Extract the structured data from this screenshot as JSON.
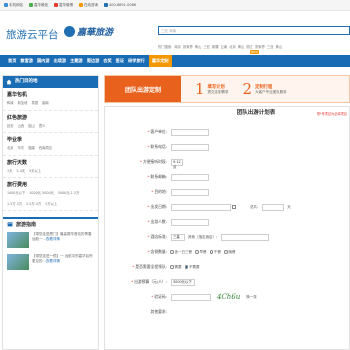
{
  "topbar": {
    "links": [
      {
        "icon": "mobile-icon",
        "label": "手机网站",
        "color": "#3a8fd8"
      },
      {
        "icon": "wechat-icon",
        "label": "嘉华微信",
        "color": "#4caf50"
      },
      {
        "icon": "weibo-icon",
        "label": "嘉华微博",
        "color": "#e53935"
      },
      {
        "icon": "tiktok-icon",
        "label": "在线咨询",
        "color": "#f39800"
      },
      {
        "icon": "phone-icon",
        "label": "400-8891-0066",
        "color": "#1f6fb2"
      }
    ]
  },
  "header": {
    "brand": "旅游云平台",
    "logo_text": "嘉華旅游",
    "search_placeholder": "三亚 海南",
    "hotlinks": [
      "热门搜索:",
      "南京",
      "张家界",
      "黄山",
      "三亚",
      "新疆",
      "云南",
      "北京",
      "黄山",
      "丽江",
      "张家界",
      "三亚",
      "黄山"
    ]
  },
  "nav": {
    "items": [
      "首页",
      "散客游",
      "国内游",
      "出境游",
      "主题游",
      "周边游",
      "会奖",
      "签证",
      "研学旅行",
      "嘉华定制"
    ],
    "active_index": 9,
    "badge": "NEW"
  },
  "sidebar": {
    "title": "热门目的地",
    "sections": [
      {
        "title": "嘉华包机",
        "items": [
          "鸭绿",
          "新加坡",
          "泰国",
          "越南"
        ]
      },
      {
        "title": "红色旅游",
        "items": [
          "延安",
          "山西",
          "韶山",
          "遵义"
        ]
      },
      {
        "title": "毕业季",
        "items": [
          "北京",
          "华东",
          "福建",
          "西南周边"
        ]
      },
      {
        "title": "旅行天数",
        "items": [
          "1天",
          "2-4天",
          "5天以上"
        ]
      },
      {
        "title": "旅行费用",
        "items": [
          "1000元以下",
          "1000元-5000元",
          "5000元-1.5万",
          "1.5万-3万",
          "2.5万-5万",
          "5万以上"
        ]
      }
    ],
    "guide_title": "旅游指南",
    "guides": [
      {
        "title": "【带您走进厦门】最高赛华首站的青春远航一...",
        "more": "查看详情"
      },
      {
        "title": "【带您走进一镜】一 远航中的嘉华后所 更见的...",
        "more": "查看详情"
      }
    ]
  },
  "banner": {
    "title": "团队出游定制",
    "steps": [
      {
        "num": "1",
        "a": "填写计划",
        "b": "提交定制需求"
      },
      {
        "num": "2",
        "a": "定制行程",
        "b": "大客户专业团队服务"
      }
    ]
  },
  "form": {
    "title": "团队出游计划表",
    "note": "带*号项目为必填项目",
    "fields": [
      {
        "label": "客户单位:",
        "req": true,
        "type": "input",
        "value": ""
      },
      {
        "label": "联系电话:",
        "req": true,
        "type": "input",
        "value": ""
      },
      {
        "label": "方便接听时段:",
        "req": true,
        "type": "select",
        "value": "9-12点"
      },
      {
        "label": "联系邮箱:",
        "req": true,
        "type": "input",
        "value": ""
      },
      {
        "label": "目的地:",
        "req": true,
        "type": "input",
        "value": ""
      },
      {
        "label": "出发日期:",
        "req": true,
        "type": "date",
        "value": "",
        "extra": "总共:",
        "extra_unit": "天"
      },
      {
        "label": "出游人数:",
        "req": true,
        "type": "input",
        "value": ""
      },
      {
        "label": "酒店标准:",
        "req": true,
        "type": "select2",
        "value": "三星",
        "extra": "其他（指定酒店）:"
      },
      {
        "label": "含餐数量:",
        "req": true,
        "type": "radios",
        "options": [
          "含一日三餐",
          "早餐",
          "午餐",
          "晚餐"
        ]
      },
      {
        "label": "是否需要全程领队:",
        "req": true,
        "type": "radios2",
        "options": [
          "需要",
          "不需要"
        ]
      },
      {
        "label": "出游预算（元/人）:",
        "req": true,
        "type": "select2",
        "value": "3000元以下"
      },
      {
        "label": "验证码:",
        "req": true,
        "type": "code",
        "code": "4Ch6u",
        "refresh": "换一张"
      },
      {
        "label": "其他要求:",
        "req": false,
        "type": "none"
      }
    ]
  }
}
